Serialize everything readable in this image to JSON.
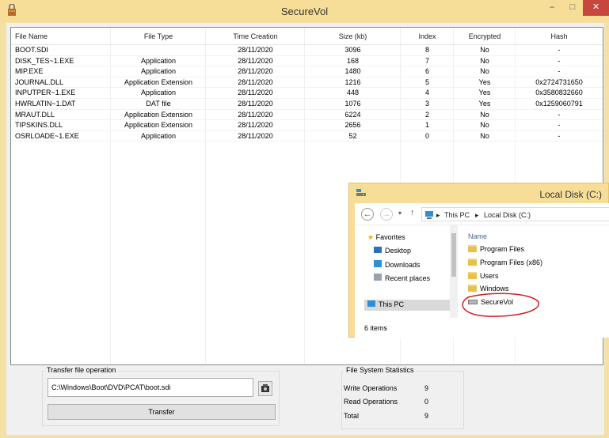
{
  "window": {
    "title": "SecureVol"
  },
  "table": {
    "headers": [
      "File Name",
      "File Type",
      "Time Creation",
      "Size (kb)",
      "Index",
      "Encrypted",
      "Hash"
    ],
    "rows": [
      [
        "BOOT.SDI",
        "",
        "28/11/2020",
        "3096",
        "8",
        "No",
        "-"
      ],
      [
        "DISK_TES~1.EXE",
        "Application",
        "28/11/2020",
        "168",
        "7",
        "No",
        "-"
      ],
      [
        "MIP.EXE",
        "Application",
        "28/11/2020",
        "1480",
        "6",
        "No",
        "-"
      ],
      [
        "JOURNAL.DLL",
        "Application Extension",
        "28/11/2020",
        "1216",
        "5",
        "Yes",
        "0x2724731650"
      ],
      [
        "INPUTPER~1.EXE",
        "Application",
        "28/11/2020",
        "448",
        "4",
        "Yes",
        "0x3580832660"
      ],
      [
        "HWRLATIN~1.DAT",
        "DAT file",
        "28/11/2020",
        "1076",
        "3",
        "Yes",
        "0x1259060791"
      ],
      [
        "MRAUT.DLL",
        "Application Extension",
        "28/11/2020",
        "6224",
        "2",
        "No",
        "-"
      ],
      [
        "TIPSKINS.DLL",
        "Application Extension",
        "28/11/2020",
        "2656",
        "1",
        "No",
        "-"
      ],
      [
        "OSRLOADE~1.EXE",
        "Application",
        "28/11/2020",
        "52",
        "0",
        "No",
        "-"
      ]
    ]
  },
  "transfer": {
    "group_label": "Transfer file operation",
    "path_value": "C:\\Windows\\Boot\\DVD\\PCAT\\boot.sdi",
    "button_label": "Transfer"
  },
  "stats": {
    "group_label": "File System Statistics",
    "write_label": "Write Operations",
    "write_value": "9",
    "read_label": "Read Operations",
    "read_value": "0",
    "total_label": "Total",
    "total_value": "9"
  },
  "explorer": {
    "title": "Local Disk (C:)",
    "breadcrumb": [
      "This PC",
      "Local Disk (C:)"
    ],
    "nav": {
      "favorites": "Favorites",
      "desktop": "Desktop",
      "downloads": "Downloads",
      "recent": "Recent places",
      "this_pc": "This PC"
    },
    "column_name": "Name",
    "items": [
      "Program Files",
      "Program Files (x86)",
      "Users",
      "Windows"
    ],
    "volume_item": "SecureVol",
    "status": "6 items"
  },
  "colors": {
    "title_bar": "#f6dd98",
    "close_button": "#c7463d",
    "annotation_circle": "#d11f1f"
  }
}
